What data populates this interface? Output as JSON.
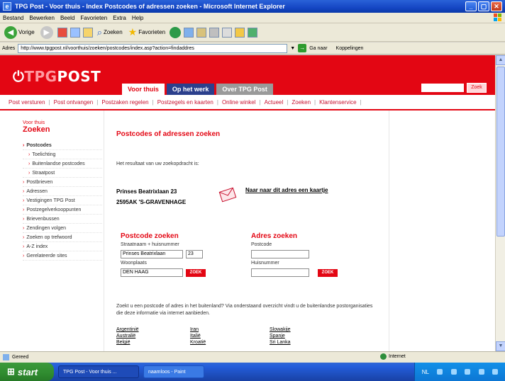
{
  "window": {
    "title": "TPG Post - Voor thuis - Index Postcodes of adressen zoeken - Microsoft Internet Explorer"
  },
  "menu": [
    "Bestand",
    "Bewerken",
    "Beeld",
    "Favorieten",
    "Extra",
    "Help"
  ],
  "toolbar": {
    "back": "Vorige",
    "search": "Zoeken",
    "favorites": "Favorieten"
  },
  "address": {
    "label": "Adres",
    "url": "http://www.tpgpost.nl/voorthuis/zoeken/postcodes/index.asp?action=findaddres",
    "go": "Ga naar",
    "links": "Koppelingen"
  },
  "site": {
    "logo_prefix": "TPG",
    "logo_suffix": "POST",
    "tabs": [
      "Voor thuis",
      "Op het werk",
      "Over TPG Post"
    ],
    "search_button": "Zoek",
    "nav": [
      "Post versturen",
      "Post ontvangen",
      "Postzaken regelen",
      "Postzegels en kaarten",
      "Online winkel",
      "Actueel",
      "Zoeken",
      "Klantenservice"
    ]
  },
  "sidebar": {
    "subtitle": "Voor thuis",
    "title": "Zoeken",
    "items": [
      {
        "label": "Postcodes",
        "bold": true,
        "sub": false
      },
      {
        "label": "Toelichting",
        "bold": false,
        "sub": true
      },
      {
        "label": "Buitenlandse postcodes",
        "bold": false,
        "sub": true
      },
      {
        "label": "Straatpost",
        "bold": false,
        "sub": true
      },
      {
        "label": "Postbrieven",
        "bold": false,
        "sub": false
      },
      {
        "label": "Adressen",
        "bold": false,
        "sub": false
      },
      {
        "label": "Vestigingen TPG Post",
        "bold": false,
        "sub": false
      },
      {
        "label": "Postzegelverkooppunten",
        "bold": false,
        "sub": false
      },
      {
        "label": "Brievenbussen",
        "bold": false,
        "sub": false
      },
      {
        "label": "Zendingen volgen",
        "bold": false,
        "sub": false
      },
      {
        "label": "Zoeken op trefwoord",
        "bold": false,
        "sub": false
      },
      {
        "label": "A-Z index",
        "bold": false,
        "sub": false
      },
      {
        "label": "Gerelateerde sites",
        "bold": false,
        "sub": false
      }
    ]
  },
  "content": {
    "heading": "Postcodes of adressen zoeken",
    "result_intro": "Het resultaat van uw zoekopdracht is:",
    "address_line1": "Prinses Beatrixlaan 23",
    "address_line2": "2595AK   'S-GRAVENHAGE",
    "map_link": "Naar naar dit adres een kaartje",
    "postcode_form": {
      "title": "Postcode zoeken",
      "street_label": "Straatnaam + huisnummer",
      "street_value": "Prinses Beatrixlaan",
      "number_value": "23",
      "city_label": "Woonplaats",
      "city_value": "DEN HAAG",
      "button": "ZOEK"
    },
    "address_form": {
      "title": "Adres zoeken",
      "postcode_label": "Postcode",
      "postcode_value": "",
      "number_label": "Huisnummer",
      "number_value": "",
      "button": "ZOEK"
    },
    "abroad_text": "Zoekt u een postcode of adres in het buitenland? Via onderstaand overzicht vindt u de buitenlandse postorganisaties die deze informatie via internet aanbieden.",
    "countries": [
      [
        "Argentinië",
        "Australië",
        "België"
      ],
      [
        "Iran",
        "Italië",
        "Kroatië"
      ],
      [
        "Slowakije",
        "Spanje",
        "Sri Lanka"
      ]
    ]
  },
  "status": {
    "left": "Gereed",
    "zone": "Internet"
  },
  "taskbar": {
    "start": "start",
    "tasks": [
      "TPG Post - Voor thuis ...",
      "naamloos - Paint"
    ],
    "clock": "NL"
  }
}
